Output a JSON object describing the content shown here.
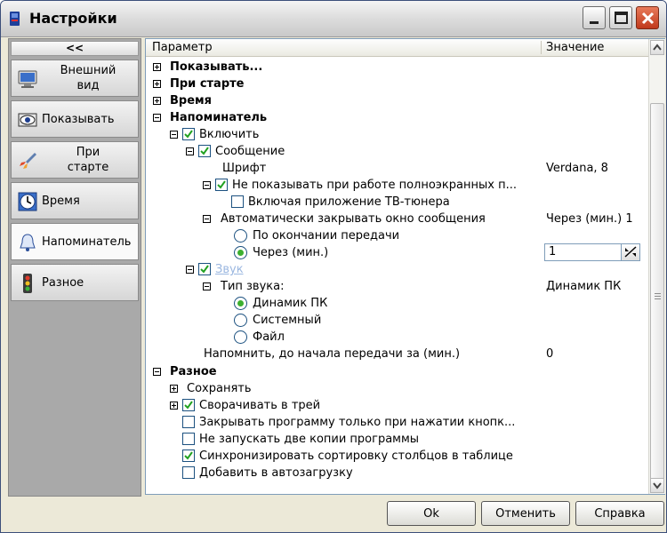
{
  "window": {
    "title": "Настройки"
  },
  "sidebar": {
    "collapse_label": "<<",
    "items": [
      {
        "label": "Внешний\nвид",
        "icon": "monitor-icon"
      },
      {
        "label": "Показывать",
        "icon": "eye-icon"
      },
      {
        "label": "При\nстарте",
        "icon": "rocket-icon"
      },
      {
        "label": "Время",
        "icon": "clock-icon"
      },
      {
        "label": "Напоминатель",
        "icon": "bell-icon",
        "active": true
      },
      {
        "label": "Разное",
        "icon": "traffic-light-icon"
      }
    ]
  },
  "tree": {
    "col_param": "Параметр",
    "col_value": "Значение",
    "rows": {
      "show": "Показывать...",
      "on_start": "При старте",
      "time": "Время",
      "reminder": "Напоминатель",
      "enable": "Включить",
      "message": "Сообщение",
      "font": "Шрифт",
      "font_value": "Verdana, 8",
      "no_fullscreen": "Не показывать при работе полноэкранных п...",
      "tv_tuner": "Включая приложение ТВ-тюнера",
      "autoclose": "Автоматически закрывать окно сообщения",
      "autoclose_value": "Через (мин.) 1",
      "after_end": "По окончании передачи",
      "after_min": "Через (мин.)",
      "after_min_value": "1",
      "sound": "Звук",
      "sound_type": "Тип звука:",
      "sound_type_value": "Динамик ПК",
      "pc_speaker": "Динамик ПК",
      "system": "Системный",
      "file": "Файл",
      "remind_before": "Напомнить, до начала передачи за (мин.)",
      "remind_before_value": "0",
      "misc": "Разное",
      "save": "Сохранять",
      "minimize_tray": "Сворачивать в трей",
      "close_only_button": "Закрывать программу только при нажатии кнопк...",
      "no_two_copies": "Не запускать две копии программы",
      "sync_sort": "Синхронизировать сортировку столбцов в таблице",
      "autostart": "Добавить в автозагрузку"
    }
  },
  "buttons": {
    "ok": "Ok",
    "cancel": "Отменить",
    "help": "Справка"
  }
}
